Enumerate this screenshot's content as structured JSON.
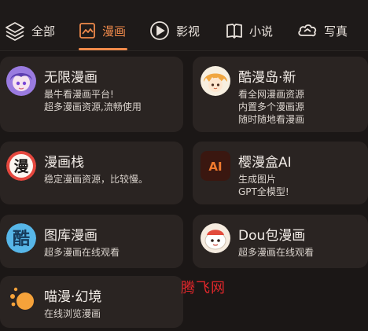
{
  "tabs": [
    {
      "label": "全部",
      "icon": "layers-icon",
      "active": false
    },
    {
      "label": "漫画",
      "icon": "image-icon",
      "active": true
    },
    {
      "label": "影视",
      "icon": "play-icon",
      "active": false
    },
    {
      "label": "小说",
      "icon": "book-icon",
      "active": false
    },
    {
      "label": "写真",
      "icon": "cloud-icon",
      "active": false
    }
  ],
  "accent_color": "#f08a4b",
  "apps": [
    {
      "title": "无限漫画",
      "desc": [
        "最牛看漫画平台!",
        "超多漫画资源,流畅使用"
      ],
      "icon": "anime-girl-icon"
    },
    {
      "title": "酷漫岛·新",
      "desc": [
        "看全网漫画资源",
        "内置多个漫画源",
        "随时随地看漫画"
      ],
      "icon": "anime-character-icon"
    },
    {
      "title": "漫画栈",
      "desc": [
        "稳定漫画资源，比较慢。"
      ],
      "icon": "man-character-icon"
    },
    {
      "title": "樱漫盒AI",
      "desc": [
        "生成图片",
        "GPT全模型!"
      ],
      "icon": "ai-logo-icon",
      "icon_text": "AI"
    },
    {
      "title": "图库漫画",
      "desc": [
        "超多漫画在线观看"
      ],
      "icon": "ku-character-icon"
    },
    {
      "title": "Dou包漫画",
      "desc": [
        "超多漫画在线观看"
      ],
      "icon": "bun-mascot-icon"
    },
    {
      "title": "喵漫·幻境",
      "desc": [
        "在线浏览漫画"
      ],
      "icon": "dots-logo-icon"
    }
  ],
  "watermark": "腾飞网"
}
